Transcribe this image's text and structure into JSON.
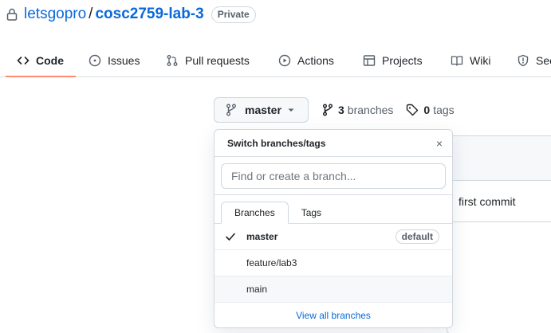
{
  "repo": {
    "owner": "letsgopro",
    "separator": "/",
    "name": "cosc2759-lab-3",
    "visibility": "Private"
  },
  "tabs": [
    {
      "label": "Code",
      "icon": "code-icon",
      "active": true
    },
    {
      "label": "Issues",
      "icon": "issue-icon"
    },
    {
      "label": "Pull requests",
      "icon": "pull-request-icon"
    },
    {
      "label": "Actions",
      "icon": "play-icon"
    },
    {
      "label": "Projects",
      "icon": "table-icon"
    },
    {
      "label": "Wiki",
      "icon": "book-icon"
    },
    {
      "label": "Sec",
      "icon": "shield-icon"
    }
  ],
  "branch_button": {
    "label": "master"
  },
  "counts": {
    "branches_num": "3",
    "branches_label": "branches",
    "tags_num": "0",
    "tags_label": "tags"
  },
  "dropdown": {
    "title": "Switch branches/tags",
    "close": "×",
    "filter_placeholder": "Find or create a branch...",
    "tabs": [
      "Branches",
      "Tags"
    ],
    "branches": [
      {
        "name": "master",
        "selected": true,
        "badge": "default"
      },
      {
        "name": "feature/lab3"
      },
      {
        "name": "main"
      }
    ],
    "footer": "View all branches"
  },
  "file_box": {
    "commit_message": "first commit"
  },
  "colors": {
    "link": "#0969da",
    "tab_underline": "#fd8c73",
    "border": "#d0d7de"
  }
}
